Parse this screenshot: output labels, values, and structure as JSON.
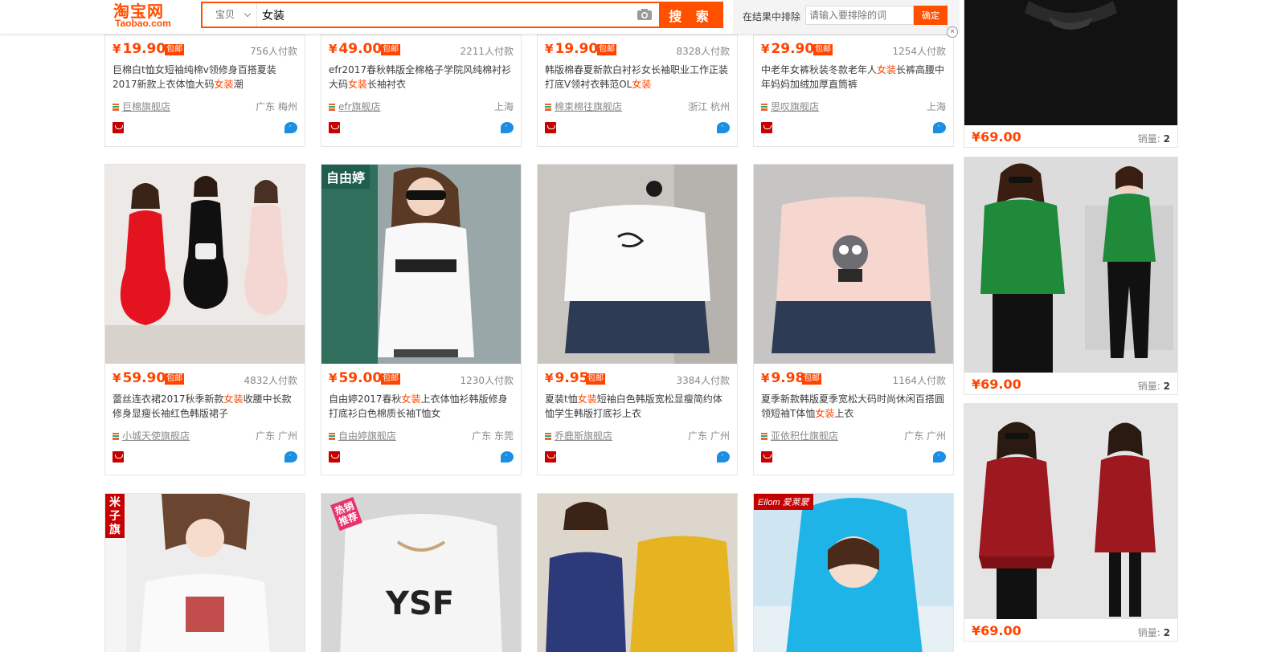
{
  "header": {
    "logo_cn": "淘宝网",
    "logo_en": "Taobao.com",
    "search_scope": "宝贝",
    "search_value": "女装",
    "search_button": "搜 索",
    "exclude_label": "在结果中排除",
    "exclude_placeholder": "请输入要排除的词",
    "exclude_button": "确定",
    "close_glyph": "×"
  },
  "rows": [
    [
      {
        "price": "19.90",
        "paid": "756人付款",
        "title_a": "巨棉白t恤女短袖纯棉v领修身百搭夏装2017新款上衣体恤大码",
        "title_hl": "女装",
        "title_b": "潮",
        "shop": "巨棉旗舰店",
        "loc": "广东 梅州"
      },
      {
        "price": "49.00",
        "paid": "2211人付款",
        "title_a": "efr2017春秋韩版全棉格子学院风纯棉衬衫大码",
        "title_hl": "女装",
        "title_b": "长袖衬衣",
        "shop": "efr旗舰店",
        "loc": "上海"
      },
      {
        "price": "19.90",
        "paid": "8328人付款",
        "title_a": "韩版棉春夏新款白衬衫女长袖职业工作正装打底V领衬衣韩范OL",
        "title_hl": "女装",
        "title_b": "",
        "shop": "棉束棉往旗舰店",
        "loc": "浙江 杭州"
      },
      {
        "price": "29.90",
        "paid": "1254人付款",
        "title_a": "中老年女裤秋装冬款老年人",
        "title_hl": "女装",
        "title_b": "长裤高腰中年妈妈加绒加厚直筒裤",
        "shop": "思叹旗舰店",
        "loc": "上海"
      }
    ],
    [
      {
        "price": "59.90",
        "paid": "4832人付款",
        "title_a": "蕾丝连衣裙2017秋季新款",
        "title_hl": "女装",
        "title_b": "收腰中长款修身显瘦长袖红色韩版裙子",
        "shop": "小城天使旗舰店",
        "loc": "广东 广州"
      },
      {
        "price": "59.00",
        "paid": "1230人付款",
        "title_a": "自由婷2017春秋",
        "title_hl": "女装",
        "title_b": "上衣体恤衫韩版修身打底衫白色棉质长袖T恤女",
        "shop": "自由婷旗舰店",
        "loc": "广东 东莞"
      },
      {
        "price": "9.95",
        "paid": "3384人付款",
        "title_a": "夏装t恤",
        "title_hl": "女装",
        "title_b": "短袖白色韩版宽松显瘦简约体恤学生韩版打底衫上衣",
        "shop": "乔鹿斯旗舰店",
        "loc": "广东 广州"
      },
      {
        "price": "9.98",
        "paid": "1164人付款",
        "title_a": "夏季新款韩版夏季宽松大码时尚休闲百搭圆领短袖T体恤",
        "title_hl": "女装",
        "title_b": "上衣",
        "shop": "亚依积仕旗舰店",
        "loc": "广东 广州"
      }
    ]
  ],
  "row3_tags": [
    "米子旗",
    "热销推荐",
    "",
    "Eilom 爱莱蒙"
  ],
  "ads": [
    {
      "price": "69.00",
      "sales_label": "销量:",
      "sales": "2"
    },
    {
      "price": "69.00",
      "sales_label": "销量:",
      "sales": "2"
    },
    {
      "price": "69.00",
      "sales_label": "销量:",
      "sales": "2"
    }
  ],
  "currency": "¥",
  "baoyou": "包邮",
  "row2_tag": "自由婷"
}
